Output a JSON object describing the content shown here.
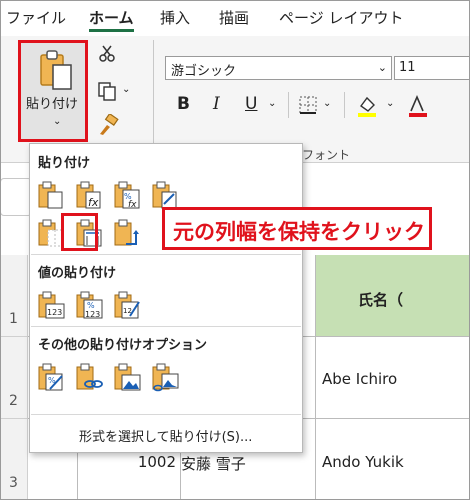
{
  "tabs": [
    {
      "label": "ファイル"
    },
    {
      "label": "ホーム"
    },
    {
      "label": "挿入"
    },
    {
      "label": "描画"
    },
    {
      "label": "ページ レイアウト"
    }
  ],
  "ribbon": {
    "paste_label": "貼り付け",
    "font_name": "游ゴシック",
    "font_size": "11",
    "bold": "B",
    "italic": "I",
    "underline": "U",
    "font_group_label": "フォント"
  },
  "paste_menu": {
    "section_paste": "貼り付け",
    "section_values": "値の貼り付け",
    "section_other": "その他の貼り付けオプション",
    "special_item": "形式を選択して貼り付け(S)...",
    "paste_icons": [
      "paste-icon",
      "paste-formulas-icon",
      "paste-formulas-number-format-icon",
      "paste-keep-source-formatting-icon",
      "paste-no-borders-icon",
      "paste-keep-source-column-widths-icon",
      "paste-transpose-icon"
    ],
    "value_icons": [
      "paste-values-icon",
      "paste-values-number-format-icon",
      "paste-values-source-formatting-icon"
    ],
    "other_icons": [
      "paste-formatting-icon",
      "paste-link-icon",
      "paste-picture-icon",
      "paste-linked-picture-icon"
    ]
  },
  "callout": {
    "text": "元の列幅を保持をクリック"
  },
  "sheet": {
    "row_numbers": [
      "1",
      "2",
      "3"
    ],
    "header_cell": "氏名（",
    "cells": {
      "b2": "Abe Ichiro",
      "id3": "1002",
      "name3": "安藤 雪子",
      "b3": "Ando Yukik"
    }
  },
  "colors": {
    "highlight": "#e0121c",
    "header_green": "#c6e0b4",
    "accent": "#1e7145"
  }
}
